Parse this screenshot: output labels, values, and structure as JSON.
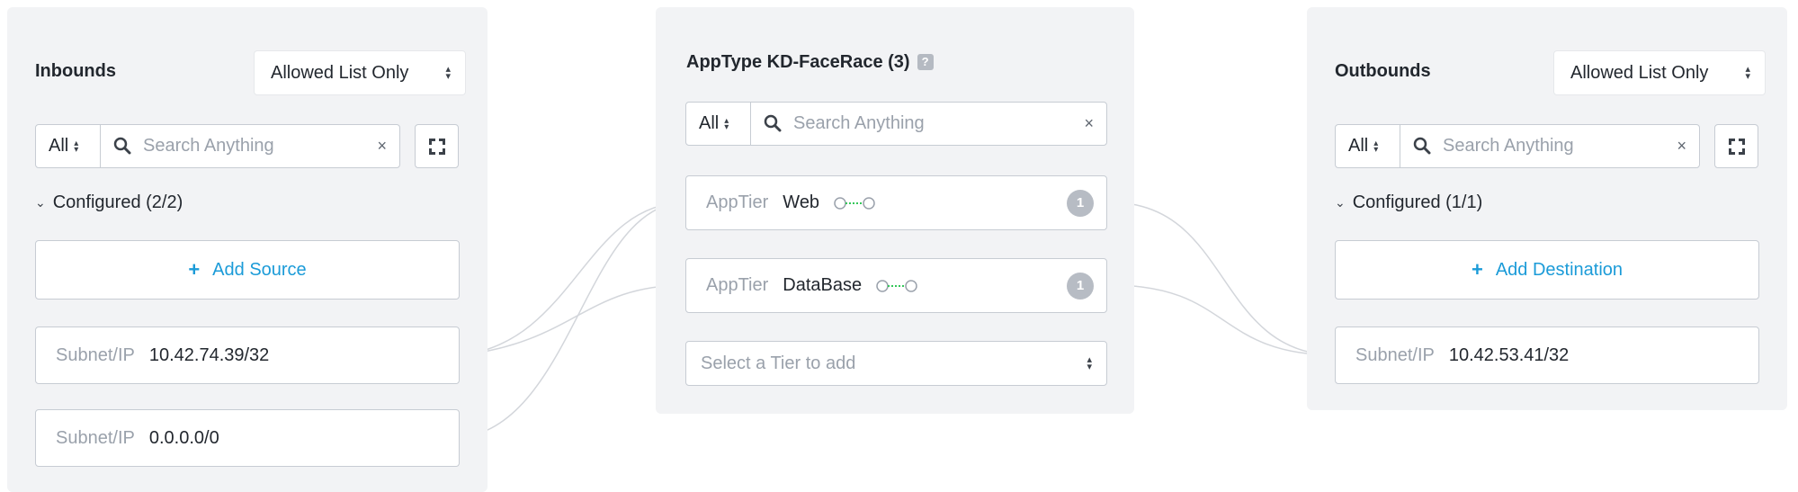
{
  "inbounds": {
    "title": "Inbounds",
    "mode": "Allowed List Only",
    "filter": "All",
    "search_placeholder": "Search Anything",
    "clear": "×",
    "group_label": "Configured (2/2)",
    "add_label": "Add Source",
    "items": [
      {
        "key": "Subnet/IP",
        "value": "10.42.74.39/32"
      },
      {
        "key": "Subnet/IP",
        "value": "0.0.0.0/0"
      }
    ]
  },
  "apptype": {
    "title": "AppType KD-FaceRace (3)",
    "help": "?",
    "filter": "All",
    "search_placeholder": "Search Anything",
    "clear": "×",
    "tiers": [
      {
        "key": "AppTier",
        "value": "Web",
        "count": "1"
      },
      {
        "key": "AppTier",
        "value": "DataBase",
        "count": "1"
      }
    ],
    "tier_select_placeholder": "Select a Tier to add"
  },
  "outbounds": {
    "title": "Outbounds",
    "mode": "Allowed List Only",
    "filter": "All",
    "search_placeholder": "Search Anything",
    "clear": "×",
    "group_label": "Configured (1/1)",
    "add_label": "Add Destination",
    "items": [
      {
        "key": "Subnet/IP",
        "value": "10.42.53.41/32"
      }
    ]
  },
  "colors": {
    "accent": "#1b9bd8",
    "panel_bg": "#f2f3f5",
    "connector": "#d3d6db",
    "link_icon": "#34c759"
  },
  "icons": [
    "search-icon",
    "expand-icon",
    "chevron-down-icon",
    "help-icon",
    "link-icon",
    "sort-icon"
  ]
}
